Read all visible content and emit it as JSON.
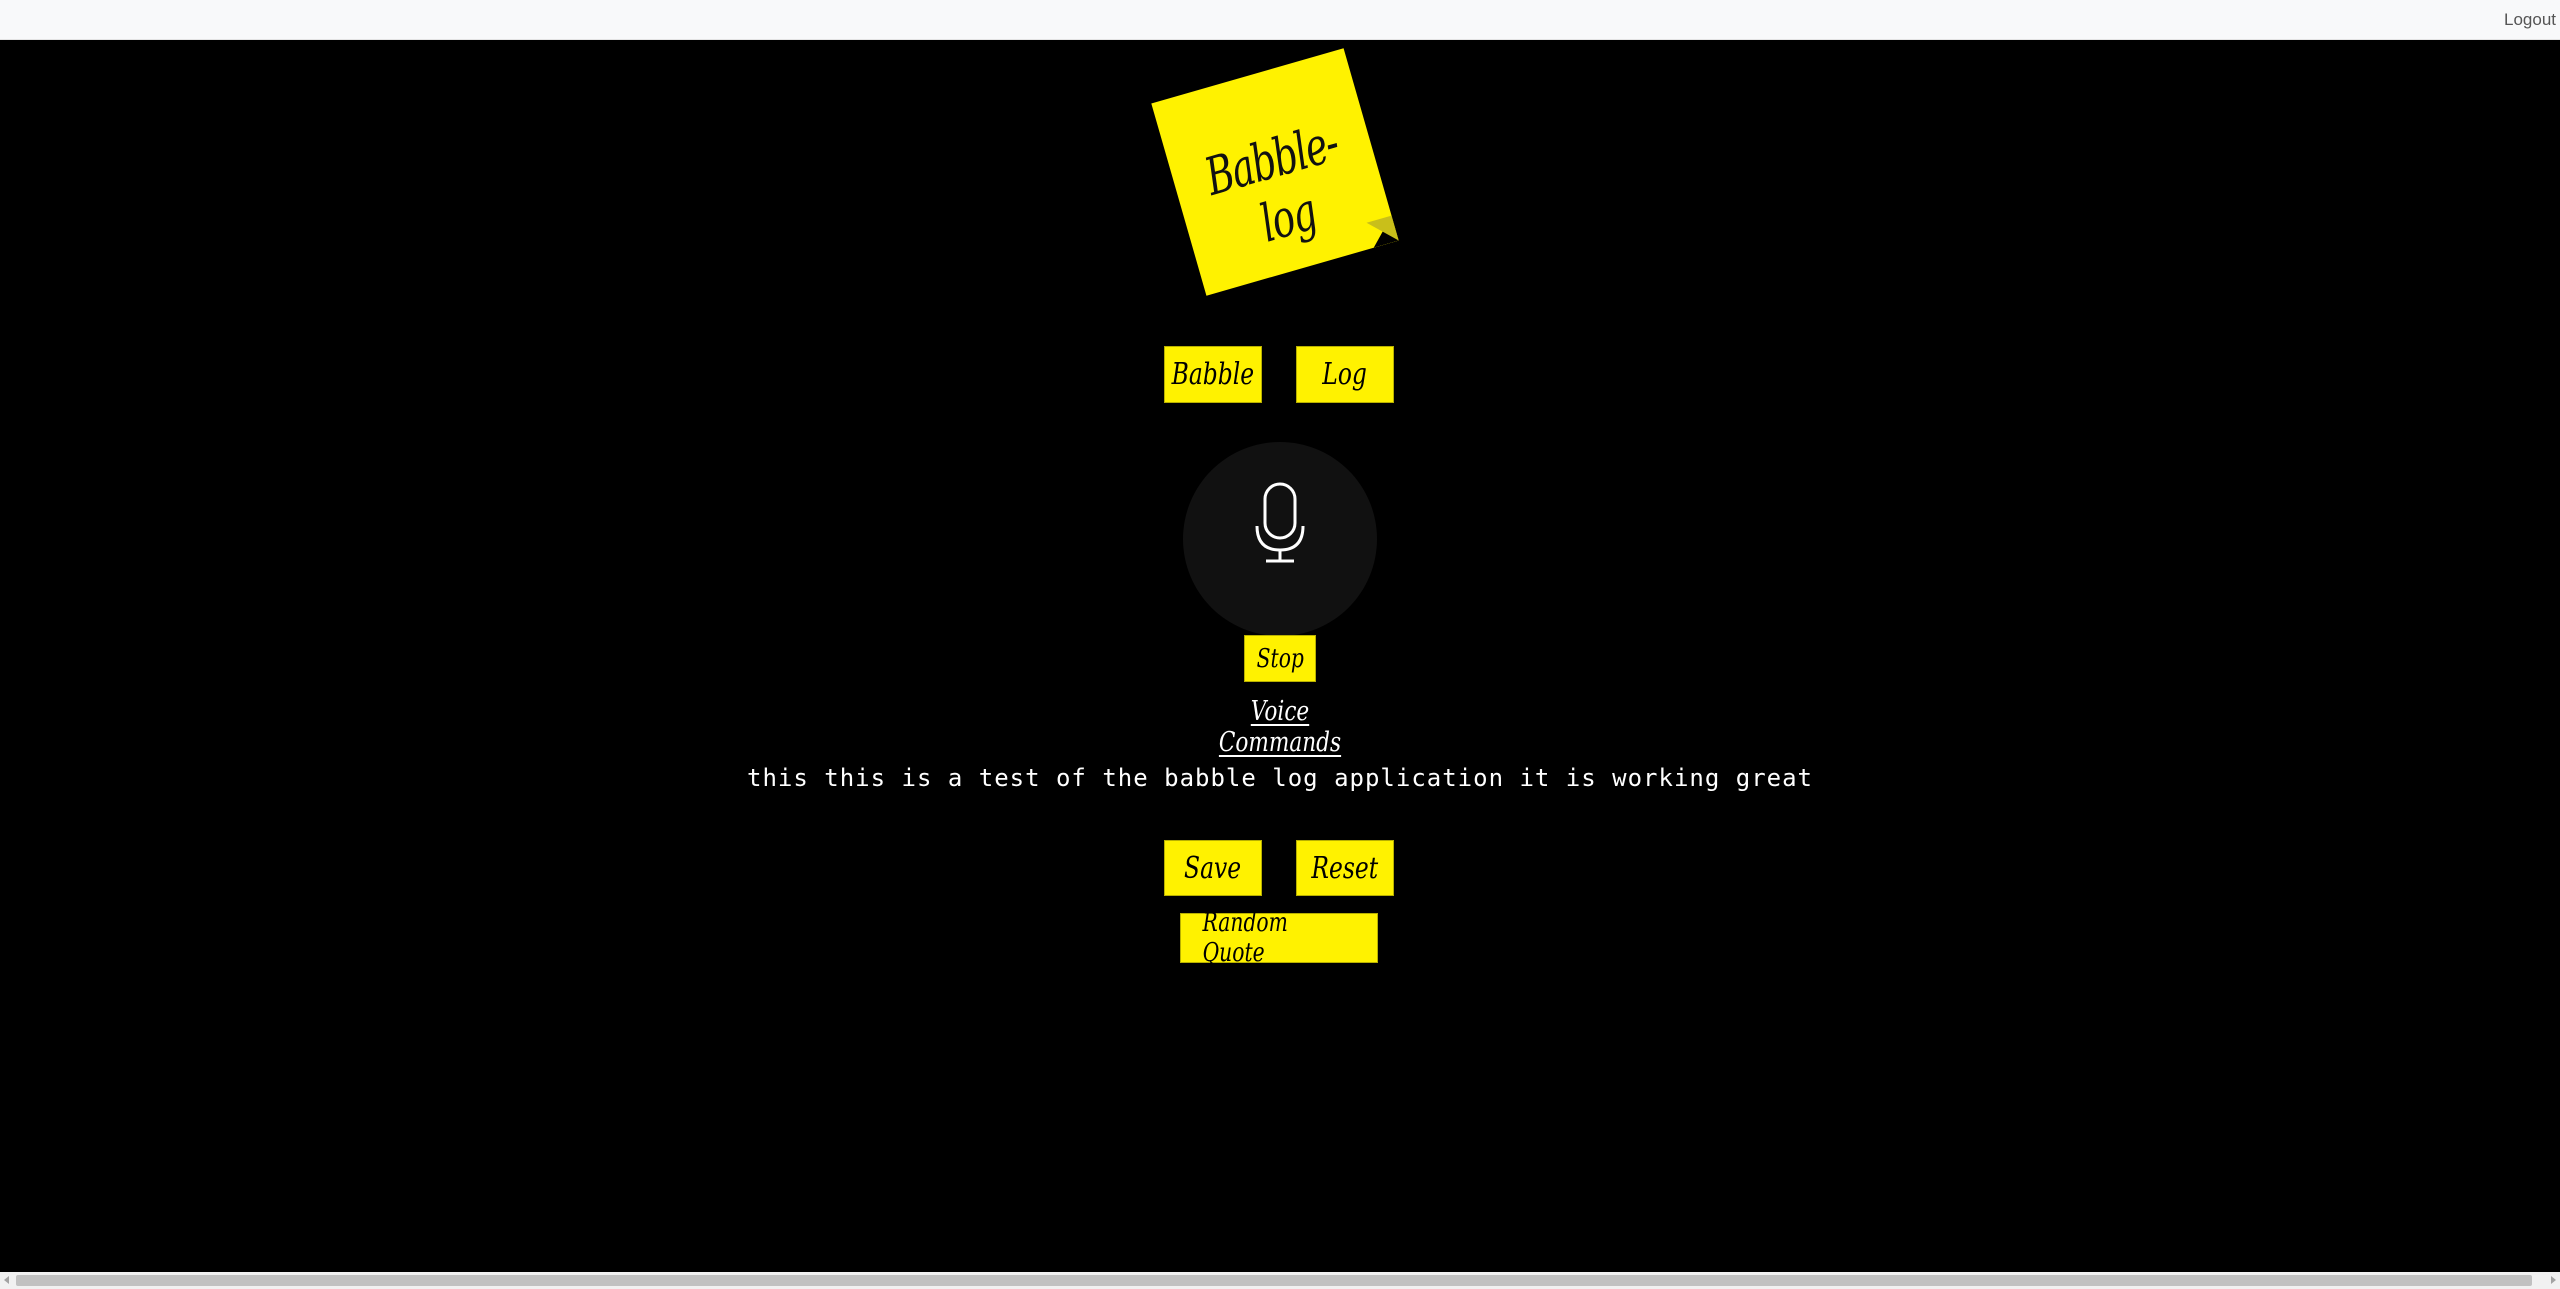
{
  "header": {
    "logout_label": "Logout"
  },
  "logo": {
    "title": "Babble-log",
    "note_color": "#fff200"
  },
  "mode_buttons": {
    "babble_label": "Babble",
    "log_label": "Log"
  },
  "recorder": {
    "mic_icon": "microphone-icon",
    "stop_label": "Stop",
    "voice_commands_label": "Voice Commands"
  },
  "transcript": {
    "text": "this this is a test of the babble log application it is working great"
  },
  "actions": {
    "save_label": "Save",
    "reset_label": "Reset",
    "random_quote_label": "Random Quote"
  },
  "colors": {
    "background": "#000000",
    "accent_yellow": "#fff200",
    "topbar": "#f8f9fa"
  }
}
